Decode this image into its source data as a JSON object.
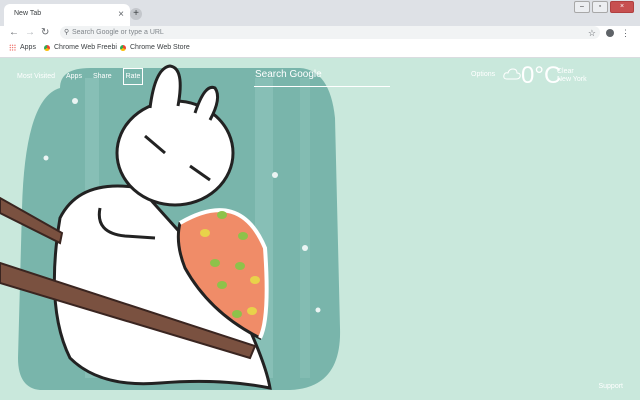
{
  "tab": {
    "title": "New Tab",
    "close": "×"
  },
  "newtab": "+",
  "window": {
    "minimize": "–",
    "maximize": "▫",
    "close": "×"
  },
  "toolbar": {
    "back": "←",
    "forward": "→",
    "reload": "↻",
    "omnibox_placeholder": "Search Google or type a URL",
    "star": "☆",
    "menu": "⋮"
  },
  "bookmarks": [
    {
      "label": "Apps"
    },
    {
      "label": "Chrome Web Freebi"
    },
    {
      "label": "Chrome Web Store"
    }
  ],
  "newtab_page": {
    "nav": [
      "Most Visited",
      "Apps",
      "Share"
    ],
    "rate": "Rate",
    "search_placeholder": "Search Google",
    "options": "Options",
    "weather": {
      "temp": "0°C",
      "condition": "Clear",
      "location": "New York"
    },
    "support": "Support"
  },
  "colors": {
    "background": "#c9e8dc",
    "blob": "#79b5ab",
    "chopstick": "#7a5140",
    "filling": "#f08c68"
  }
}
